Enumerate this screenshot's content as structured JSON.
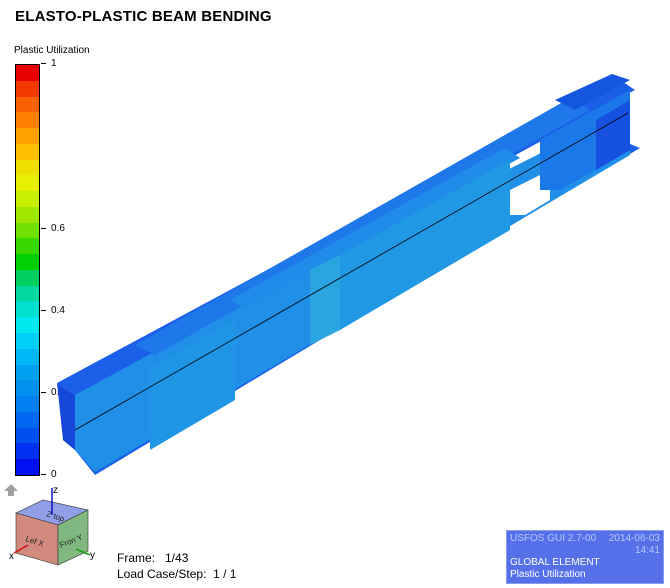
{
  "title": "ELASTO-PLASTIC BEAM BENDING",
  "legend": {
    "title": "Plastic Utilization",
    "ticks": [
      {
        "label": "1",
        "value": 1
      },
      {
        "label": "0.6",
        "value": 0.6
      },
      {
        "label": "0.4",
        "value": 0.4
      },
      {
        "label": "0.2",
        "value": 0.2
      },
      {
        "label": "0",
        "value": 0
      }
    ],
    "colors": [
      "#e80000",
      "#f03a00",
      "#f86000",
      "#ff8000",
      "#ffa000",
      "#ffc000",
      "#f0e000",
      "#e8f000",
      "#c8f000",
      "#a0e800",
      "#70e000",
      "#38d800",
      "#00d000",
      "#00d060",
      "#00d8a0",
      "#00e0d0",
      "#00e8f0",
      "#00d0f8",
      "#00b8f8",
      "#00a0f0",
      "#0090f0",
      "#0080f0",
      "#0068f0",
      "#0050f0",
      "#0030f0",
      "#0010f0"
    ],
    "colors_note": ""
  },
  "axis_cube": {
    "faces": [
      "Z top",
      "Lef X",
      "Fron Y"
    ],
    "axes": [
      "z",
      "x",
      "y"
    ],
    "colors": {
      "x": "#d01010",
      "y": "#10a010",
      "z": "#1010c0"
    }
  },
  "frame_info": {
    "frame": "Frame:   1/43",
    "loadcase": "Load Case/Step:  1 / 1"
  },
  "info_box": {
    "version": "USFOS GUI 2.7-00",
    "date": "2014-06-03",
    "time": "14:41",
    "line1": "GLOBAL ELEMENT",
    "line2": "Plastic Utilization",
    "bg_color": "#5570e8"
  }
}
